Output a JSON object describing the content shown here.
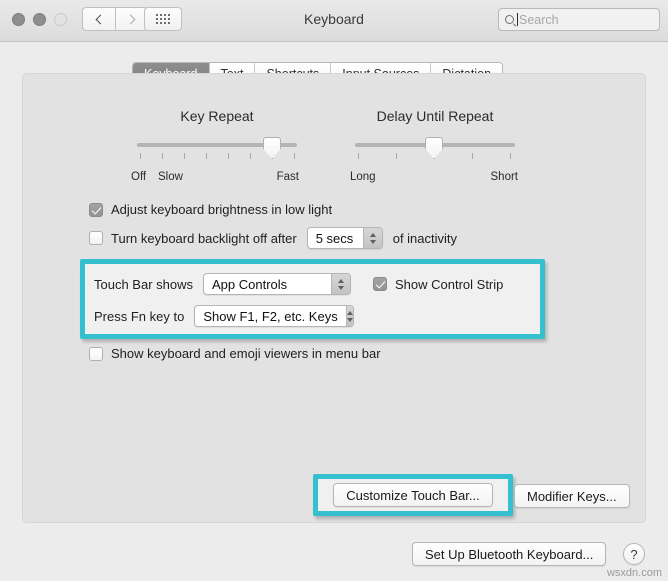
{
  "window": {
    "title": "Keyboard",
    "traffic_lights": [
      "close",
      "minimize",
      "zoom"
    ],
    "nav_back": "‹",
    "nav_forward": "›",
    "grid_button": "show-all-icon"
  },
  "search": {
    "placeholder": "Search",
    "value": "",
    "icon": "search-icon"
  },
  "tabs": [
    {
      "label": "Keyboard",
      "active": true
    },
    {
      "label": "Text",
      "active": false
    },
    {
      "label": "Shortcuts",
      "active": false
    },
    {
      "label": "Input Sources",
      "active": false
    },
    {
      "label": "Dictation",
      "active": false
    }
  ],
  "sliders": [
    {
      "title": "Key Repeat",
      "left_label": "Off",
      "second_label": "Slow",
      "right_label": "Fast",
      "ticks": 8,
      "value_index": 7,
      "min": 1,
      "max": 8
    },
    {
      "title": "Delay Until Repeat",
      "left_label": "Long",
      "right_label": "Short",
      "ticks": 5,
      "value_index": 3,
      "min": 1,
      "max": 5
    }
  ],
  "checkboxes": {
    "adjust_brightness": {
      "label": "Adjust keyboard brightness in low light",
      "checked": true
    },
    "backlight_off": {
      "label_before": "Turn keyboard backlight off after",
      "label_after": "of inactivity",
      "checked": false,
      "duration_value": "5 secs"
    },
    "show_control_strip": {
      "label": "Show Control Strip",
      "checked": true
    },
    "show_viewers": {
      "label": "Show keyboard and emoji viewers in menu bar",
      "checked": false
    }
  },
  "touch_bar": {
    "shows_label": "Touch Bar shows",
    "shows_value": "App Controls",
    "fn_label": "Press Fn key to",
    "fn_value": "Show F1, F2, etc. Keys"
  },
  "buttons": {
    "customize_touch_bar": "Customize Touch Bar...",
    "modifier_keys": "Modifier Keys...",
    "set_up_bluetooth": "Set Up Bluetooth Keyboard...",
    "help": "?"
  },
  "highlight_color": "#34c0ce",
  "watermark": "wsxdn.com"
}
